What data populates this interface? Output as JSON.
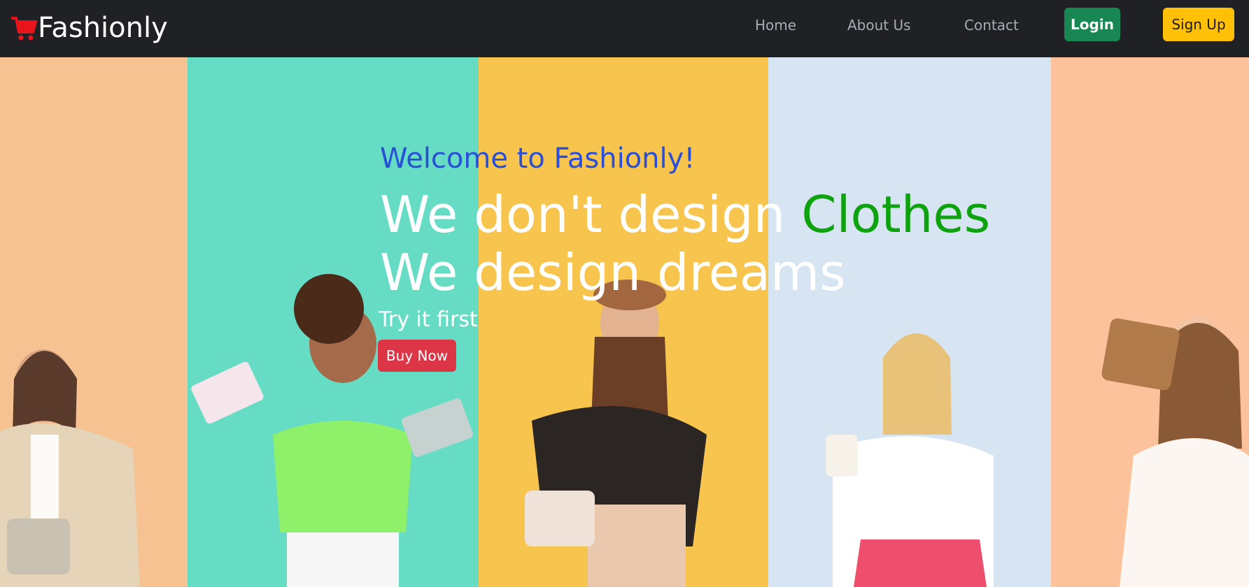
{
  "brand": {
    "name": "Fashionly",
    "icon": "cart-icon",
    "icon_color": "#e8141b"
  },
  "nav": {
    "links": [
      {
        "label": "Home"
      },
      {
        "label": "About Us"
      },
      {
        "label": "Contact"
      }
    ],
    "login_label": "Login",
    "signup_label": "Sign Up"
  },
  "hero": {
    "welcome": "Welcome to Fashionly!",
    "headline_part1": "We don't design ",
    "headline_accent": "Clothes",
    "headline_line2": "We design dreams",
    "tagline": "Try it first",
    "cta_label": "Buy Now"
  },
  "colors": {
    "navbar_bg": "#202125",
    "welcome": "#2a4fd7",
    "accent_green": "#0ea20e",
    "login_bg": "#198754",
    "signup_bg": "#ffc107",
    "buy_bg": "#dc3545"
  }
}
